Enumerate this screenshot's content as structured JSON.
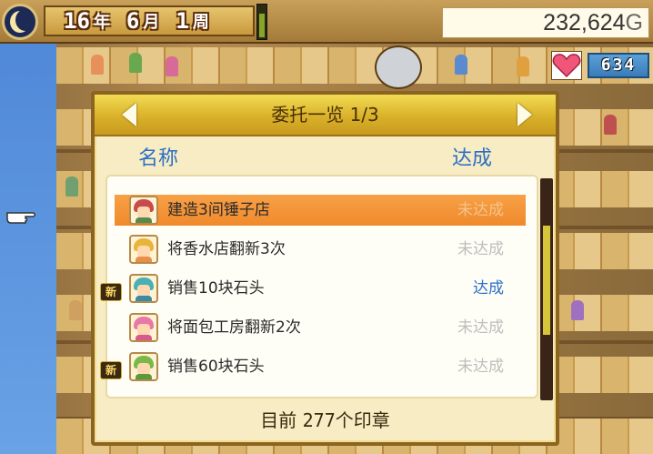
{
  "hud": {
    "year": "16",
    "year_unit": "年",
    "month": "6",
    "month_unit": "月",
    "week": "1",
    "week_unit": "周",
    "week_progress": 0.8,
    "money": "232,624",
    "money_unit": "G",
    "hearts": "634"
  },
  "dialog": {
    "title": "委托一览 1/3",
    "col_name": "名称",
    "col_status": "达成",
    "items": [
      {
        "label": "建造3间锤子店",
        "status": "未达成",
        "selected": true,
        "new": false
      },
      {
        "label": "将香水店翻新3次",
        "status": "未达成",
        "selected": false,
        "new": false
      },
      {
        "label": "销售10块石头",
        "status": "达成",
        "selected": false,
        "new": true
      },
      {
        "label": "将面包工房翻新2次",
        "status": "未达成",
        "selected": false,
        "new": false
      },
      {
        "label": "销售60块石头",
        "status": "未达成",
        "selected": false,
        "new": true
      }
    ],
    "new_badge": "新",
    "footer_prefix": "目前",
    "footer_count": "277",
    "footer_suffix": "个印章"
  },
  "colors": {
    "accent_orange": "#f08a2c",
    "heading_blue": "#2b6fc6",
    "title_gold": "#d9b12a"
  }
}
